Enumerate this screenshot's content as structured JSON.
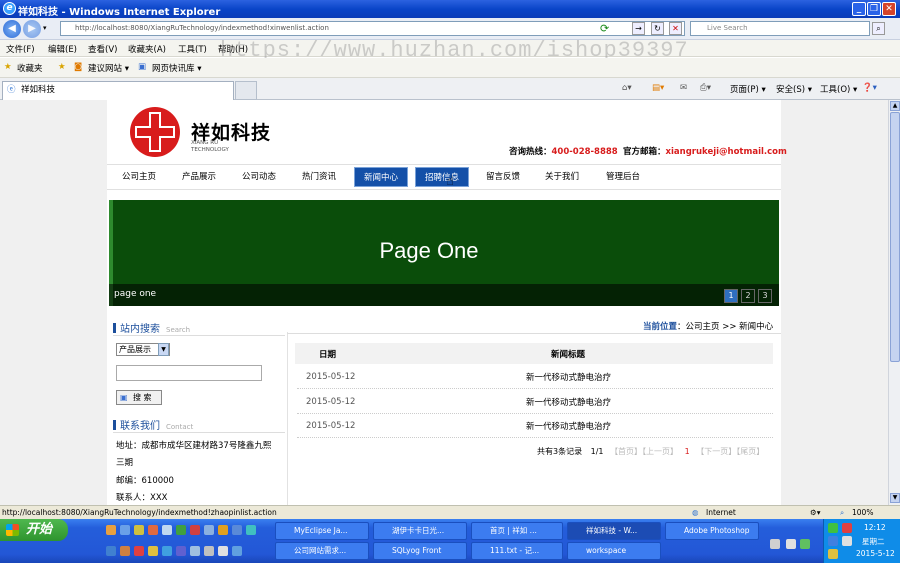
{
  "window": {
    "title": "祥如科技 - Windows Internet Explorer"
  },
  "address": {
    "url": "http://localhost:8080/XiangRuTechnology/indexmethod!xinwenlist.action",
    "search_placeholder": "Live Search"
  },
  "menubar": [
    "文件(F)",
    "编辑(E)",
    "查看(V)",
    "收藏夹(A)",
    "工具(T)",
    "帮助(H)"
  ],
  "watermark": "https://www.huzhan.com/ishop39397",
  "favorites": {
    "label": "收藏夹",
    "items": [
      "建议网站 ▾",
      "网页快讯库 ▾"
    ]
  },
  "tab": {
    "label": "祥如科技"
  },
  "toolbar_right": {
    "page": "页面(P) ▾",
    "safety": "安全(S) ▾",
    "tools": "工具(O) ▾",
    "help": "❓▾"
  },
  "site": {
    "logo_cn": "祥如科技",
    "logo_en_1": "XIANG RU",
    "logo_en_2": "TECHNOLOGY",
    "hotline_label": "咨询热线：",
    "hotline": "400-028-8888",
    "email_label": "官方邮箱：",
    "email": "xiangrukeji@hotmail.com",
    "nav": [
      "公司主页",
      "产品展示",
      "公司动态",
      "热门资讯",
      "新闻中心",
      "招聘信息",
      "留言反馈",
      "关于我们",
      "管理后台"
    ],
    "nav_active": "新闻中心",
    "banner": {
      "title": "Page One",
      "caption": "page one",
      "pages": [
        "1",
        "2",
        "3"
      ],
      "active_page": "1"
    },
    "search_section": {
      "title": "站内搜索",
      "sub": "Search",
      "select": "产品展示",
      "button": "搜 索"
    },
    "contact_section": {
      "title": "联系我们",
      "sub": "Contact",
      "address": "地址：成都市成华区建材路37号隆鑫九熙",
      "address2": "三期",
      "postcode": "邮编：610000",
      "contact": "联系人：XXX"
    },
    "breadcrumb": {
      "label": "当前位置",
      "path": "：公司主页 >> 新闻中心"
    },
    "table": {
      "headers": [
        "日期",
        "新闻标题"
      ],
      "rows": [
        {
          "date": "2015-05-12",
          "title": "新一代移动式静电治疗"
        },
        {
          "date": "2015-05-12",
          "title": "新一代移动式静电治疗"
        },
        {
          "date": "2015-05-12",
          "title": "新一代移动式静电治疗"
        }
      ]
    },
    "pager": {
      "summary": "共有3条记录",
      "pages": "1/1",
      "first": "【首页】",
      "prev": "【上一页】",
      "current": "1",
      "next": "【下一页】",
      "last": "【尾页】"
    }
  },
  "status": {
    "url": "http://localhost:8080/XiangRuTechnology/indexmethod!zhaopinlist.action",
    "zone": "Internet",
    "zoom": "100%"
  },
  "taskbar": {
    "start": "开始",
    "row1": [
      "MyEclipse Ja...",
      "湖伊卡卡日光...",
      "首页 | 祥如 ...",
      "祥如科技 - W...",
      "Adobe Photoshop"
    ],
    "row2": [
      "公司网站需求...",
      "SQLyog Front",
      "111.txt - 记...",
      "workspace"
    ],
    "clock": "12:12",
    "weekday": "星期二",
    "date": "2015-5-12"
  }
}
